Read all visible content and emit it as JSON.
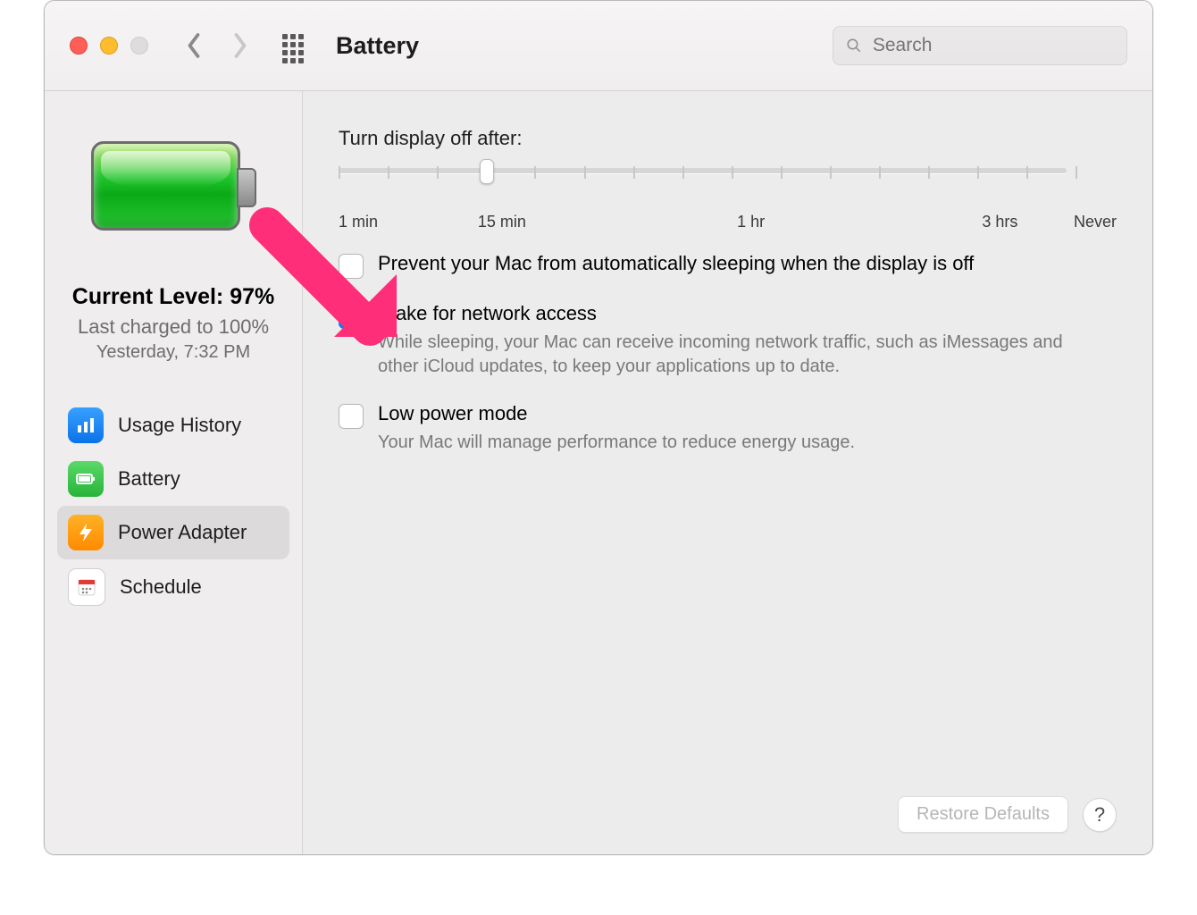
{
  "header": {
    "title": "Battery",
    "search_placeholder": "Search"
  },
  "sidebar": {
    "current_level_label": "Current Level: 97%",
    "last_charged_label": "Last charged to 100%",
    "last_charged_time": "Yesterday, 7:32 PM",
    "items": [
      {
        "label": "Usage History"
      },
      {
        "label": "Battery"
      },
      {
        "label": "Power Adapter"
      },
      {
        "label": "Schedule"
      }
    ],
    "selected_index": 2
  },
  "main": {
    "slider_title": "Turn display off after:",
    "slider_labels": {
      "min1": "1 min",
      "min15": "15 min",
      "hr1": "1 hr",
      "hr3": "3 hrs",
      "never": "Never"
    },
    "options": [
      {
        "title": "Prevent your Mac from automatically sleeping when the display is off",
        "desc": "",
        "checked": false
      },
      {
        "title": "Wake for network access",
        "desc": "While sleeping, your Mac can receive incoming network traffic, such as iMessages and other iCloud updates, to keep your applications up to date.",
        "checked": true
      },
      {
        "title": "Low power mode",
        "desc": "Your Mac will manage performance to reduce energy usage.",
        "checked": false
      }
    ],
    "restore_button": "Restore Defaults",
    "help_label": "?"
  }
}
